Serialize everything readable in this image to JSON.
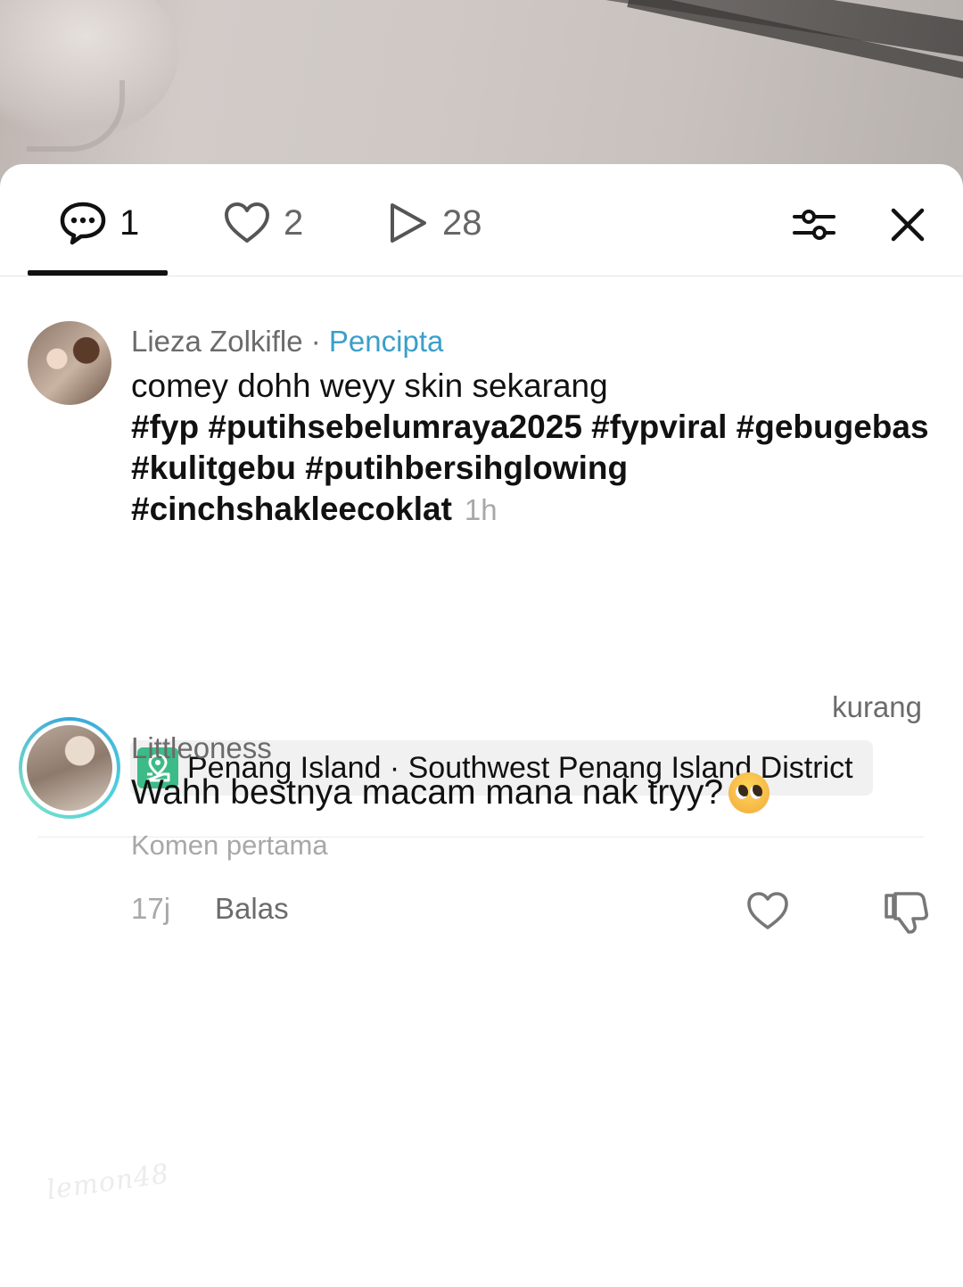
{
  "tabs": {
    "comments_count": "1",
    "likes_count": "2",
    "views_count": "28"
  },
  "post": {
    "author": "Lieza Zolkifle",
    "separator": " · ",
    "creator_label": "Pencipta",
    "caption": "comey dohh weyy skin sekarang",
    "hashtags": "#fyp #putihsebelumraya2025 #fypviral #gebugebas #kulitgebu #putihbersihglowing #cinchshakleecoklat",
    "time": "1h",
    "less_label": "kurang",
    "location": "Penang Island · Southwest Penang Island District"
  },
  "comment": {
    "username": "Littleoness",
    "text": "Wahh bestnya macam mana nak tryy?",
    "emoji_name": "pleading-face-emoji",
    "subtitle": "Komen pertama",
    "age": "17j",
    "reply_label": "Balas"
  },
  "watermark": "lemon48",
  "colors": {
    "creator_accent": "#3a9fc9",
    "location_icon_bg": "#3dbb87",
    "ring_accent": "#3aa7d9"
  }
}
